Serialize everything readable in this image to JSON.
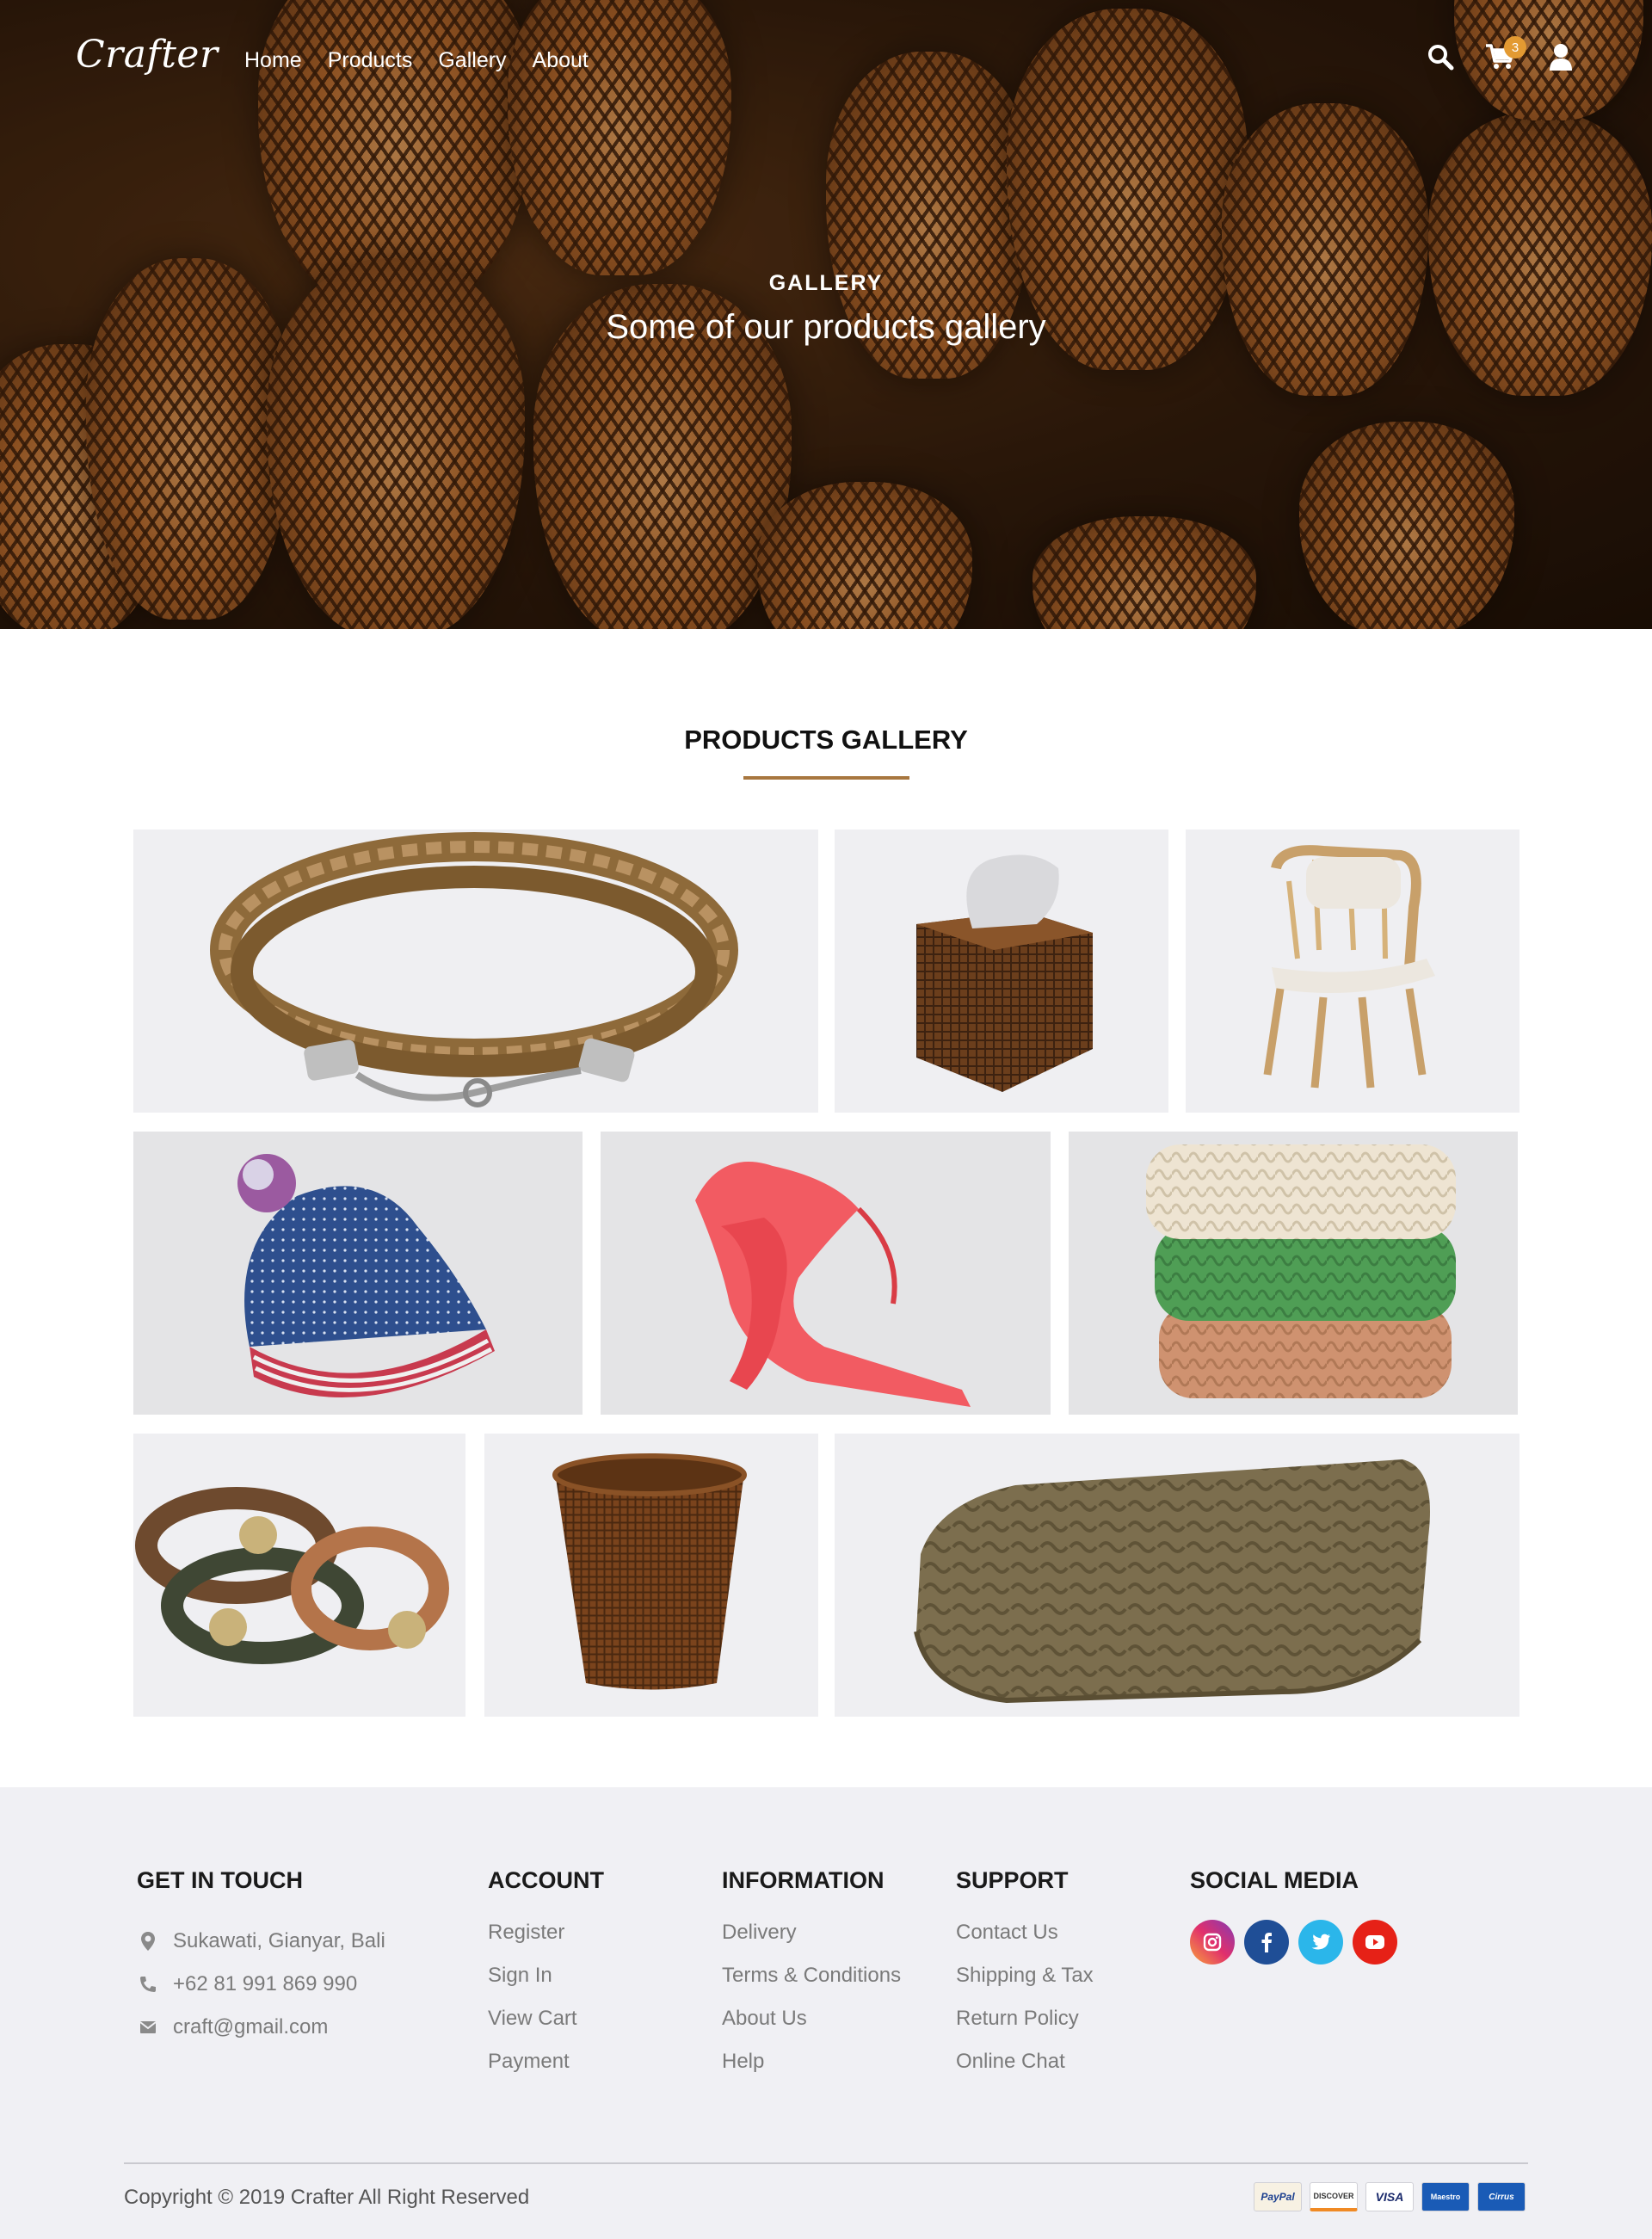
{
  "nav": {
    "logo": "Crafter",
    "links": [
      "Home",
      "Products",
      "Gallery",
      "About"
    ],
    "cart_count": "3",
    "icons": [
      "search-icon",
      "cart-icon",
      "user-icon"
    ]
  },
  "hero": {
    "kicker": "GALLERY",
    "title": "Some of our products gallery"
  },
  "gallery": {
    "title": "PRODUCTS GALLERY",
    "accent": "#a8773f",
    "items": [
      "braided leather necklace",
      "rattan tissue box",
      "rattan armchair",
      "knit beanie",
      "coral scarf",
      "knit blanket stack",
      "leather bracelets",
      "rattan waste basket",
      "knit throw blanket"
    ]
  },
  "footer": {
    "touch": {
      "heading": "GET IN TOUCH",
      "address": "Sukawati, Gianyar, Bali",
      "phone": "+62 81 991 869 990",
      "email": "craft@gmail.com"
    },
    "account": {
      "heading": "ACCOUNT",
      "links": [
        "Register",
        "Sign In",
        "View Cart",
        "Payment"
      ]
    },
    "information": {
      "heading": "INFORMATION",
      "links": [
        "Delivery",
        "Terms & Conditions",
        "About Us",
        "Help"
      ]
    },
    "support": {
      "heading": "SUPPORT",
      "links": [
        "Contact Us",
        "Shipping & Tax",
        "Return Policy",
        "Online Chat"
      ]
    },
    "social": {
      "heading": "SOCIAL MEDIA",
      "icons": [
        "instagram-icon",
        "facebook-icon",
        "twitter-icon",
        "youtube-icon"
      ]
    },
    "copyright": "Copyright © 2019 Crafter All Right Reserved",
    "payments": [
      "PayPal",
      "DISCOVER",
      "VISA",
      "Maestro",
      "Cirrus"
    ]
  }
}
